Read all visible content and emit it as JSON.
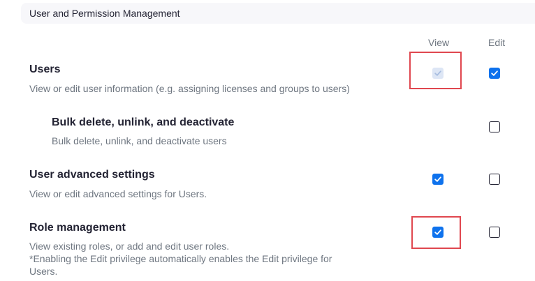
{
  "section": {
    "title": "User and Permission Management"
  },
  "columns": {
    "view": "View",
    "edit": "Edit"
  },
  "rows": [
    {
      "title": "Users",
      "description": "View or edit user information (e.g. assigning licenses and groups to users)",
      "view": "checked-disabled",
      "edit": "checked"
    },
    {
      "title": "Bulk delete, unlink, and deactivate",
      "description": "Bulk delete, unlink, and deactivate users",
      "view": "none",
      "edit": "unchecked"
    },
    {
      "title": "User advanced settings",
      "description": "View or edit advanced settings for Users.",
      "view": "checked",
      "edit": "unchecked"
    },
    {
      "title": "Role management",
      "description_lines": [
        "View existing roles, or add and edit user roles.",
        "*Enabling the Edit privilege automatically enables the Edit privilege for",
        "Users."
      ],
      "view": "checked",
      "edit": "unchecked"
    }
  ],
  "colors": {
    "accent": "#0e72ed",
    "disabled_check": "#dde6f5",
    "highlight": "#e0474f",
    "muted_text": "#6e7680"
  }
}
